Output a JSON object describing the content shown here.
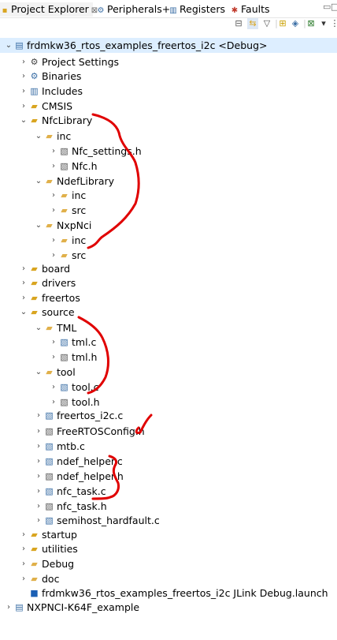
{
  "tabs": [
    {
      "label": "Project Explorer",
      "icon": "project-explorer-icon",
      "close": "⌘",
      "active": true
    },
    {
      "label": "Peripherals+",
      "icon": "peripherals-icon",
      "active": false
    },
    {
      "label": "Registers",
      "icon": "registers-icon",
      "active": false
    },
    {
      "label": "Faults",
      "icon": "faults-icon",
      "active": false
    }
  ],
  "colors": {
    "selection": "#ddeeff",
    "annotation": "#e00000",
    "folder": "#d9a520"
  },
  "tree": [
    {
      "label": "frdmkw36_rtos_examples_freertos_i2c <Debug>",
      "icon": "project-icon",
      "twisty": "open",
      "selected": true
    },
    {
      "label": "Project Settings",
      "icon": "settings-icon",
      "twisty": "closed"
    },
    {
      "label": "Binaries",
      "icon": "binaries-icon",
      "twisty": "closed"
    },
    {
      "label": "Includes",
      "icon": "includes-icon",
      "twisty": "closed"
    },
    {
      "label": "CMSIS",
      "icon": "source-folder-icon",
      "twisty": "closed"
    },
    {
      "label": "NfcLibrary",
      "icon": "source-folder-icon",
      "twisty": "open"
    },
    {
      "label": "inc",
      "icon": "folder-icon",
      "twisty": "open"
    },
    {
      "label": "Nfc_settings.h",
      "icon": "header-file-icon",
      "twisty": "closed"
    },
    {
      "label": "Nfc.h",
      "icon": "header-file-icon",
      "twisty": "closed"
    },
    {
      "label": "NdefLibrary",
      "icon": "folder-icon",
      "twisty": "open"
    },
    {
      "label": "inc",
      "icon": "folder-icon",
      "twisty": "closed"
    },
    {
      "label": "src",
      "icon": "folder-icon",
      "twisty": "closed"
    },
    {
      "label": "NxpNci",
      "icon": "folder-icon",
      "twisty": "open"
    },
    {
      "label": "inc",
      "icon": "folder-icon",
      "twisty": "closed"
    },
    {
      "label": "src",
      "icon": "folder-icon",
      "twisty": "closed"
    },
    {
      "label": "board",
      "icon": "source-folder-icon",
      "twisty": "closed"
    },
    {
      "label": "drivers",
      "icon": "source-folder-icon",
      "twisty": "closed"
    },
    {
      "label": "freertos",
      "icon": "source-folder-icon",
      "twisty": "closed"
    },
    {
      "label": "source",
      "icon": "source-folder-icon",
      "twisty": "open"
    },
    {
      "label": "TML",
      "icon": "folder-icon",
      "twisty": "open"
    },
    {
      "label": "tml.c",
      "icon": "c-file-icon",
      "twisty": "closed"
    },
    {
      "label": "tml.h",
      "icon": "header-file-icon",
      "twisty": "closed"
    },
    {
      "label": "tool",
      "icon": "folder-icon",
      "twisty": "open"
    },
    {
      "label": "tool.c",
      "icon": "c-file-icon",
      "twisty": "closed"
    },
    {
      "label": "tool.h",
      "icon": "header-file-icon",
      "twisty": "closed"
    },
    {
      "label": "freertos_i2c.c",
      "icon": "c-file-icon",
      "twisty": "closed"
    },
    {
      "label": "FreeRTOSConfig.h",
      "icon": "header-file-icon",
      "twisty": "closed"
    },
    {
      "label": "mtb.c",
      "icon": "c-file-icon",
      "twisty": "closed"
    },
    {
      "label": "ndef_helper.c",
      "icon": "c-file-icon",
      "twisty": "closed"
    },
    {
      "label": "ndef_helper.h",
      "icon": "header-file-icon",
      "twisty": "closed"
    },
    {
      "label": "nfc_task.c",
      "icon": "c-file-icon",
      "twisty": "closed"
    },
    {
      "label": "nfc_task.h",
      "icon": "header-file-icon",
      "twisty": "closed"
    },
    {
      "label": "semihost_hardfault.c",
      "icon": "c-file-icon",
      "twisty": "closed"
    },
    {
      "label": "startup",
      "icon": "source-folder-icon",
      "twisty": "closed"
    },
    {
      "label": "utilities",
      "icon": "source-folder-icon",
      "twisty": "closed"
    },
    {
      "label": "Debug",
      "icon": "folder-icon",
      "twisty": "closed"
    },
    {
      "label": "doc",
      "icon": "folder-icon",
      "twisty": "closed"
    },
    {
      "label": "frdmkw36_rtos_examples_freertos_i2c JLink Debug.launch",
      "icon": "launch-file-icon",
      "twisty": "none"
    },
    {
      "label": "NXPNCI-K64F_example",
      "icon": "project-icon",
      "twisty": "closed"
    }
  ]
}
